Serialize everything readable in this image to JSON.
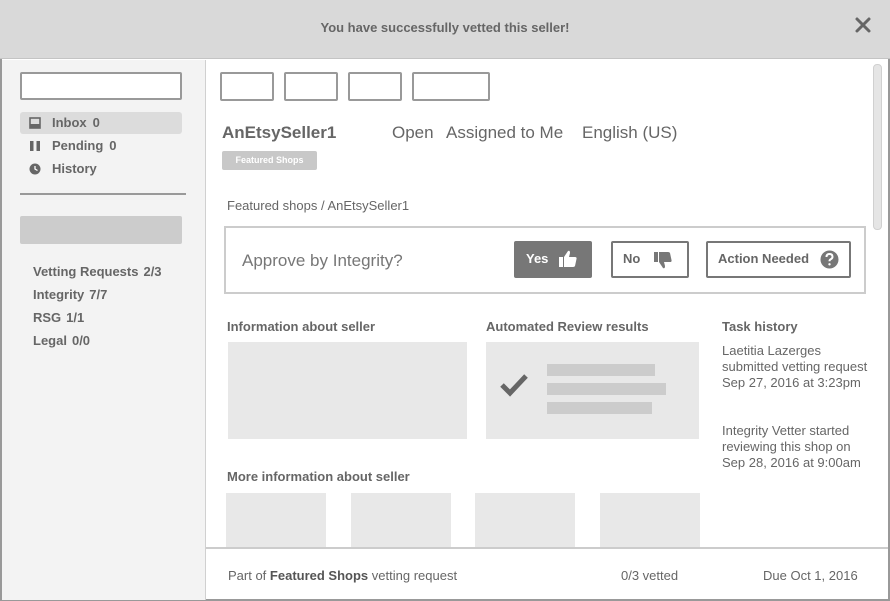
{
  "banner": {
    "message": "You have successfully vetted this seller!",
    "close_icon": "close-icon"
  },
  "sidebar": {
    "search_placeholder": "",
    "nav": [
      {
        "label": "Inbox",
        "count": "0",
        "icon": "inbox-icon",
        "active": true
      },
      {
        "label": "Pending",
        "count": "0",
        "icon": "pause-icon",
        "active": false
      },
      {
        "label": "History",
        "count": "",
        "icon": "clock-icon",
        "active": false
      }
    ],
    "categories": [
      {
        "label": "Vetting Requests",
        "count": "2/3"
      },
      {
        "label": "Integrity",
        "count": "7/7"
      },
      {
        "label": "RSG",
        "count": "1/1"
      },
      {
        "label": "Legal",
        "count": "0/0"
      }
    ]
  },
  "seller": {
    "name": "AnEtsySeller1",
    "status": "Open",
    "assignment": "Assigned to Me",
    "language": "English (US)",
    "badge": "Featured Shops"
  },
  "breadcrumb": "Featured shops / AnEtsySeller1",
  "approve": {
    "question": "Approve by Integrity?",
    "yes_label": "Yes",
    "no_label": "No",
    "action_label": "Action Needed"
  },
  "sections": {
    "info": "Information about seller",
    "automated": "Automated Review results",
    "task_history": "Task history",
    "more_info": "More information about seller"
  },
  "history": [
    "Laetitia Lazerges submitted vetting request Sep 27, 2016 at 3:23pm",
    "Integrity Vetter started reviewing this shop on Sep 28, 2016 at 9:00am"
  ],
  "footer": {
    "prefix": "Part of",
    "request_name": "Featured Shops",
    "suffix": "vetting request",
    "progress": "0/3 vetted",
    "due": "Due Oct 1, 2016"
  },
  "colors": {
    "banner_bg": "#d9d9d9",
    "yes_button_bg": "#777777",
    "placeholder": "#e8e8e8"
  }
}
